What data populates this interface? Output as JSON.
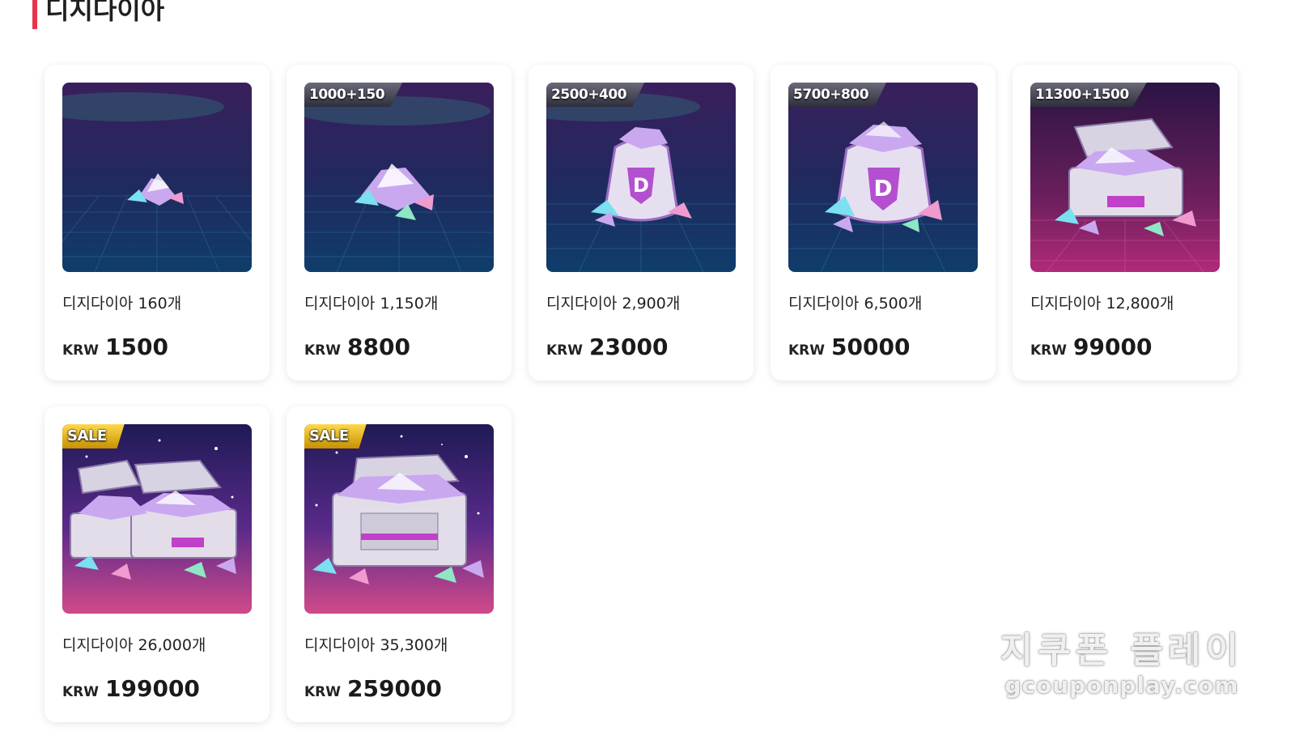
{
  "section": {
    "title": "디지다이아"
  },
  "colors": {
    "accent": "#e8344e"
  },
  "products": [
    {
      "badge": "",
      "name": "디지다이아 160개",
      "currency": "KRW",
      "price": "1500",
      "art": "pile-small"
    },
    {
      "badge": "1000+150",
      "name": "디지다이아 1,150개",
      "currency": "KRW",
      "price": "8800",
      "art": "pile-medium"
    },
    {
      "badge": "2500+400",
      "name": "디지다이아 2,900개",
      "currency": "KRW",
      "price": "23000",
      "art": "bag"
    },
    {
      "badge": "5700+800",
      "name": "디지다이아 6,500개",
      "currency": "KRW",
      "price": "50000",
      "art": "bag-large"
    },
    {
      "badge": "11300+1500",
      "name": "디지다이아 12,800개",
      "currency": "KRW",
      "price": "99000",
      "art": "chest"
    },
    {
      "badge": "SALE",
      "name": "디지다이아 26,000개",
      "currency": "KRW",
      "price": "199000",
      "art": "double-chest"
    },
    {
      "badge": "SALE",
      "name": "디지다이아 35,300개",
      "currency": "KRW",
      "price": "259000",
      "art": "big-chest"
    }
  ],
  "watermark": {
    "korean": "지쿠폰 플레이",
    "url": "gcouponplay.com"
  }
}
